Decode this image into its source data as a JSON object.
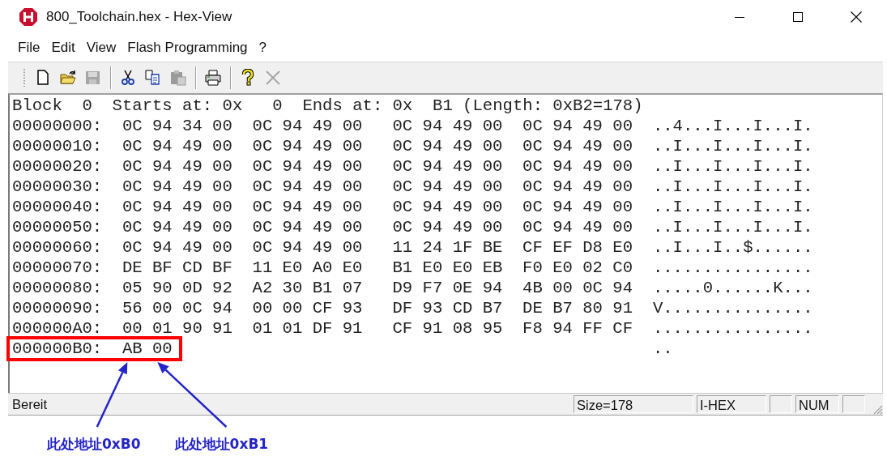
{
  "window": {
    "title": "800_Toolchain.hex - Hex-View"
  },
  "menu": [
    "File",
    "Edit",
    "View",
    "Flash Programming",
    "?"
  ],
  "toolbar": [
    [
      {
        "kind": "new",
        "disabled": false
      },
      {
        "kind": "open",
        "disabled": false
      },
      {
        "kind": "save",
        "disabled": true
      }
    ],
    [
      {
        "kind": "cut",
        "disabled": false
      },
      {
        "kind": "copy",
        "disabled": false
      },
      {
        "kind": "paste",
        "disabled": true
      }
    ],
    [
      {
        "kind": "print",
        "disabled": false
      }
    ],
    [
      {
        "kind": "help",
        "disabled": false
      },
      {
        "kind": "close",
        "disabled": true
      }
    ]
  ],
  "hex_view": {
    "header": "Block  0  Starts at: 0x   0  Ends at: 0x  B1 (Length: 0xB2=178)",
    "rows": [
      {
        "address": "00000000:",
        "bytes": [
          "0C",
          "94",
          "34",
          "00",
          "0C",
          "94",
          "49",
          "00",
          "0C",
          "94",
          "49",
          "00",
          "0C",
          "94",
          "49",
          "00"
        ],
        "ascii": "..4...I...I...I.",
        "highlighted": false
      },
      {
        "address": "00000010:",
        "bytes": [
          "0C",
          "94",
          "49",
          "00",
          "0C",
          "94",
          "49",
          "00",
          "0C",
          "94",
          "49",
          "00",
          "0C",
          "94",
          "49",
          "00"
        ],
        "ascii": "..I...I...I...I.",
        "highlighted": false
      },
      {
        "address": "00000020:",
        "bytes": [
          "0C",
          "94",
          "49",
          "00",
          "0C",
          "94",
          "49",
          "00",
          "0C",
          "94",
          "49",
          "00",
          "0C",
          "94",
          "49",
          "00"
        ],
        "ascii": "..I...I...I...I.",
        "highlighted": false
      },
      {
        "address": "00000030:",
        "bytes": [
          "0C",
          "94",
          "49",
          "00",
          "0C",
          "94",
          "49",
          "00",
          "0C",
          "94",
          "49",
          "00",
          "0C",
          "94",
          "49",
          "00"
        ],
        "ascii": "..I...I...I...I.",
        "highlighted": false
      },
      {
        "address": "00000040:",
        "bytes": [
          "0C",
          "94",
          "49",
          "00",
          "0C",
          "94",
          "49",
          "00",
          "0C",
          "94",
          "49",
          "00",
          "0C",
          "94",
          "49",
          "00"
        ],
        "ascii": "..I...I...I...I.",
        "highlighted": false
      },
      {
        "address": "00000050:",
        "bytes": [
          "0C",
          "94",
          "49",
          "00",
          "0C",
          "94",
          "49",
          "00",
          "0C",
          "94",
          "49",
          "00",
          "0C",
          "94",
          "49",
          "00"
        ],
        "ascii": "..I...I...I...I.",
        "highlighted": false
      },
      {
        "address": "00000060:",
        "bytes": [
          "0C",
          "94",
          "49",
          "00",
          "0C",
          "94",
          "49",
          "00",
          "11",
          "24",
          "1F",
          "BE",
          "CF",
          "EF",
          "D8",
          "E0"
        ],
        "ascii": "..I...I..$......",
        "highlighted": false
      },
      {
        "address": "00000070:",
        "bytes": [
          "DE",
          "BF",
          "CD",
          "BF",
          "11",
          "E0",
          "A0",
          "E0",
          "B1",
          "E0",
          "E0",
          "EB",
          "F0",
          "E0",
          "02",
          "C0"
        ],
        "ascii": "................",
        "highlighted": false
      },
      {
        "address": "00000080:",
        "bytes": [
          "05",
          "90",
          "0D",
          "92",
          "A2",
          "30",
          "B1",
          "07",
          "D9",
          "F7",
          "0E",
          "94",
          "4B",
          "00",
          "0C",
          "94"
        ],
        "ascii": ".....0......K...",
        "highlighted": false
      },
      {
        "address": "00000090:",
        "bytes": [
          "56",
          "00",
          "0C",
          "94",
          "00",
          "00",
          "CF",
          "93",
          "DF",
          "93",
          "CD",
          "B7",
          "DE",
          "B7",
          "80",
          "91"
        ],
        "ascii": "V...............",
        "highlighted": false
      },
      {
        "address": "000000A0:",
        "bytes": [
          "00",
          "01",
          "90",
          "91",
          "01",
          "01",
          "DF",
          "91",
          "CF",
          "91",
          "08",
          "95",
          "F8",
          "94",
          "FF",
          "CF"
        ],
        "ascii": "................",
        "highlighted": false
      },
      {
        "address": "000000B0:",
        "bytes": [
          "AB",
          "00"
        ],
        "ascii": "..",
        "highlighted": true
      }
    ]
  },
  "status_bar": {
    "message": "Bereit",
    "panes": [
      {
        "kind": "field",
        "text": "Size=178"
      },
      {
        "kind": "field",
        "text": "I-HEX"
      },
      {
        "kind": "indicator"
      },
      {
        "kind": "indicator",
        "text": "NUM"
      },
      {
        "kind": "indicator"
      }
    ]
  },
  "annotations": [
    {
      "text": "此处地址0xB0"
    },
    {
      "text": "此处地址0xB1"
    }
  ]
}
